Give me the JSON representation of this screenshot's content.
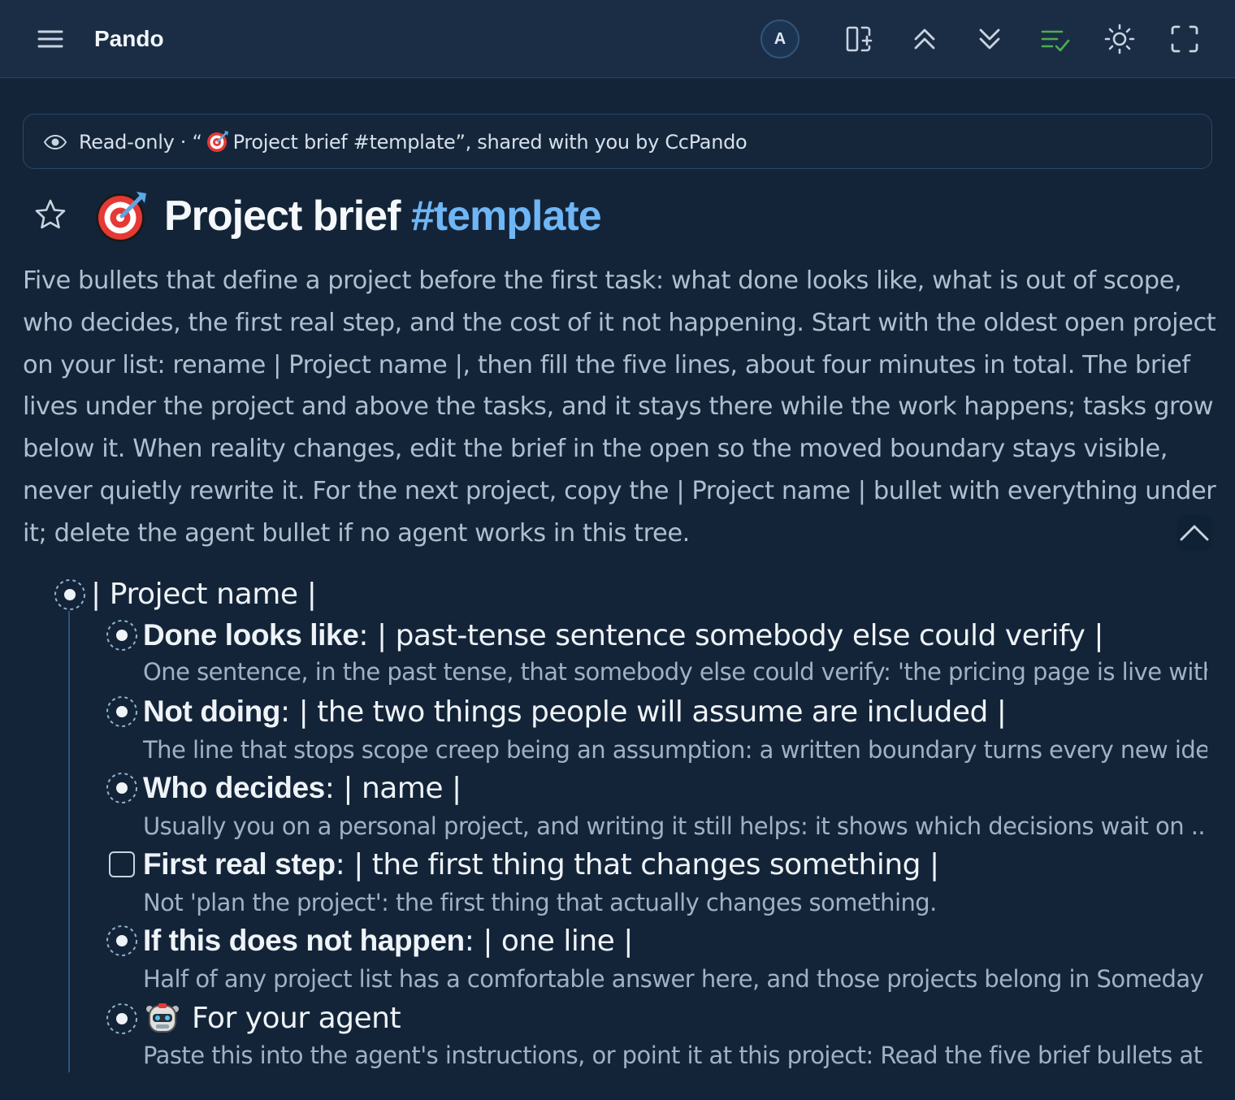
{
  "app": {
    "title": "Pando"
  },
  "toolbar": {
    "avatar_initial": "A",
    "icons": [
      "menu-icon",
      "add-panel-icon",
      "collapse-all-icon",
      "expand-all-icon",
      "checklist-icon",
      "theme-sun-icon",
      "fullscreen-icon"
    ],
    "accent_colors": {
      "checklist": "#4caf50",
      "tag": "#6fb6f5"
    }
  },
  "banner": {
    "text_before": "Read-only · “",
    "doc_name": "Project brief #template",
    "text_after": "”, shared with you by CcPando"
  },
  "page": {
    "title": "Project brief",
    "tag": "#template",
    "starred": false,
    "description": "Five bullets that define a project before the first task: what done looks like, what is out of scope, who decides, the first real step, and the cost of it not happening. Start with the oldest open project on your list: rename | Project name |, then fill the five lines, about four minutes in total. The brief lives under the project and above the tasks, and it stays there while the work happens; tasks grow below it. When reality changes, edit the brief in the open so the moved boundary stays visible, never quietly rewrite it. For the next project, copy the | Project name | bullet with everything under it; delete the agent bullet if no agent works in this tree."
  },
  "outline": {
    "root": "| Project name |",
    "items": [
      {
        "label": "Done looks like",
        "rest": ": | past-tense sentence somebody else could verify |",
        "note": "One sentence, in the past tense, that somebody else could verify: 'the pricing page is live with ...",
        "type": "bullet"
      },
      {
        "label": "Not doing",
        "rest": ": | the two things people will assume are included |",
        "note": "The line that stops scope creep being an assumption: a written boundary turns every new idea ...",
        "type": "bullet"
      },
      {
        "label": "Who decides",
        "rest": ": | name |",
        "note": "Usually you on a personal project, and writing it still helps: it shows which decisions wait on ...",
        "type": "bullet"
      },
      {
        "label": "First real step",
        "rest": ": | the first thing that changes something |",
        "note": "Not 'plan the project': the first thing that actually changes something.",
        "type": "checkbox",
        "checked": false
      },
      {
        "label": "If this does not happen",
        "rest": ": | one line |",
        "note": "Half of any project list has a comfortable answer here, and those projects belong in Someday ...",
        "type": "bullet"
      },
      {
        "label": "",
        "rest": "For your agent",
        "note": "Paste this into the agent's instructions, or point it at this project: Read the five brief bullets at th...",
        "type": "bullet",
        "icon": "robot-emoji-icon"
      }
    ]
  }
}
